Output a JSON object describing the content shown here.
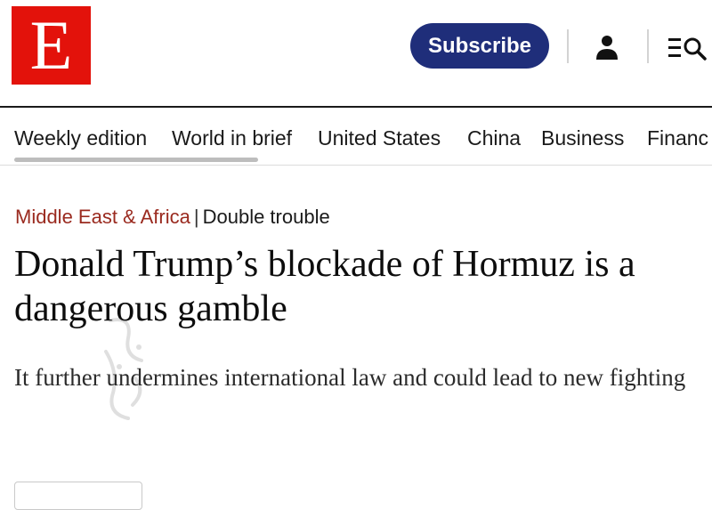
{
  "header": {
    "logo_letter": "E",
    "subscribe_label": "Subscribe",
    "icons": [
      "user-icon",
      "menu-search-icon"
    ],
    "brand_color": "#e3120b",
    "subscribe_color": "#1f2e7a"
  },
  "nav": {
    "items": [
      "Weekly edition",
      "World in brief",
      "United States",
      "China",
      "Business",
      "Financ"
    ]
  },
  "article": {
    "section": "Middle East & Africa",
    "separator": "|",
    "rubric": "Double trouble",
    "headline": "Donald Trump’s blockade of Hormuz is a dangerous gamble",
    "standfirst": "It further undermines international law and could lead to new fighting",
    "section_color": "#9a2a1f"
  }
}
